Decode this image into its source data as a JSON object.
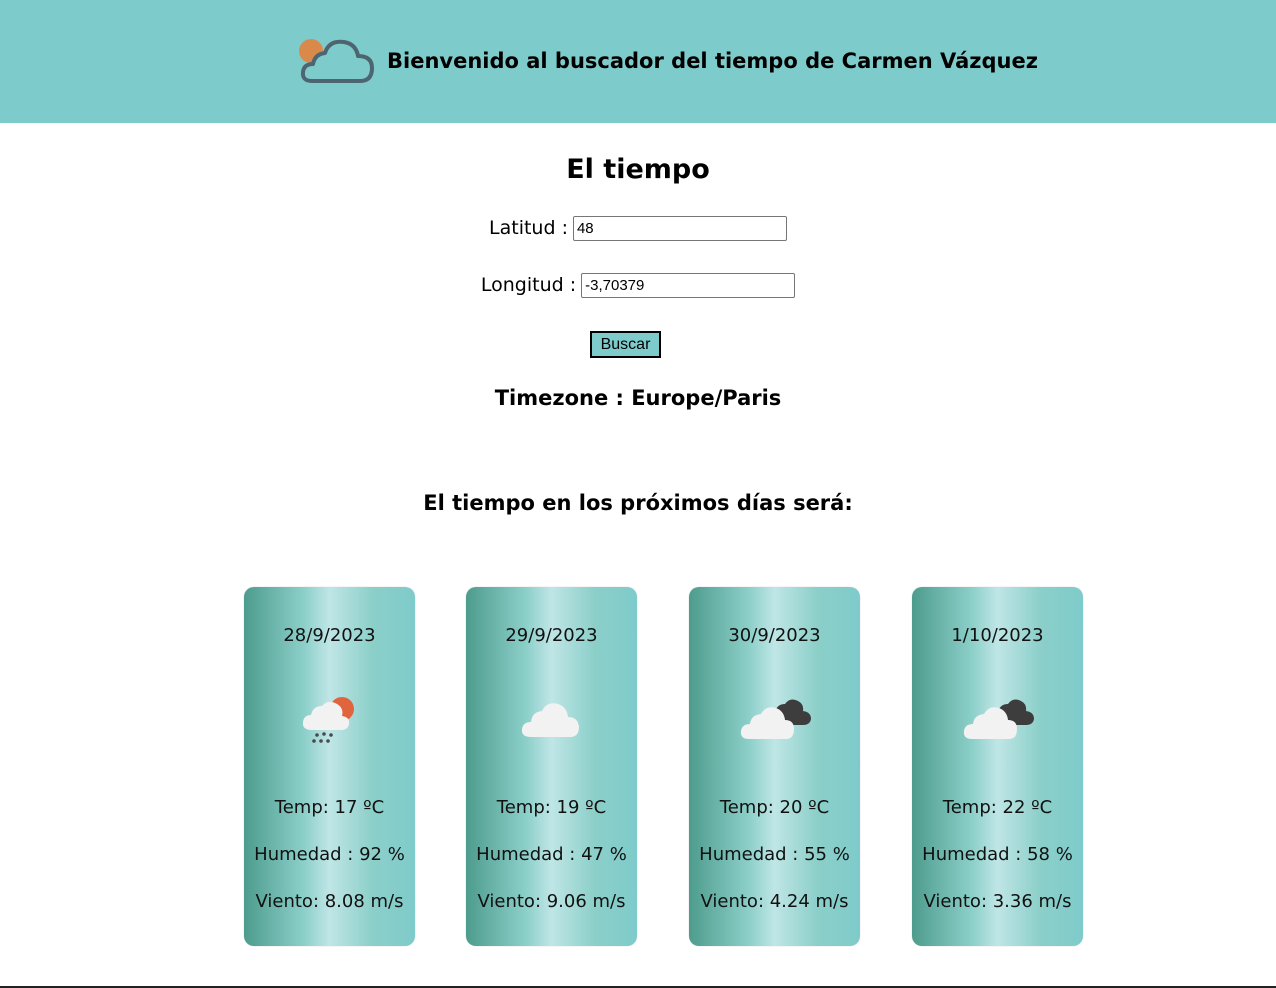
{
  "header": {
    "title": "Bienvenido al buscador del tiempo de Carmen Vázquez",
    "logo_icon": "cloud-sun-icon",
    "background": "#7ecbcb"
  },
  "main": {
    "title": "El tiempo",
    "latitude": {
      "label": "Latitud :",
      "value": "48"
    },
    "longitude": {
      "label": "Longitud :",
      "value": "-3,70379"
    },
    "search_label": "Buscar",
    "timezone": "Timezone : Europe/Paris",
    "forecast_heading": "El tiempo en los próximos días será:"
  },
  "forecast": [
    {
      "date": "28/9/2023",
      "icon": "rain-cloud-sun-icon",
      "temp": "Temp: 17 ºC",
      "humidity": "Humedad : 92 %",
      "wind": "Viento: 8.08 m/s"
    },
    {
      "date": "29/9/2023",
      "icon": "cloud-icon",
      "temp": "Temp: 19 ºC",
      "humidity": "Humedad : 47 %",
      "wind": "Viento: 9.06 m/s"
    },
    {
      "date": "30/9/2023",
      "icon": "broken-clouds-icon",
      "temp": "Temp: 20 ºC",
      "humidity": "Humedad : 55 %",
      "wind": "Viento: 4.24 m/s"
    },
    {
      "date": "1/10/2023",
      "icon": "broken-clouds-icon",
      "temp": "Temp: 22 ºC",
      "humidity": "Humedad : 58 %",
      "wind": "Viento: 3.36 m/s"
    }
  ]
}
